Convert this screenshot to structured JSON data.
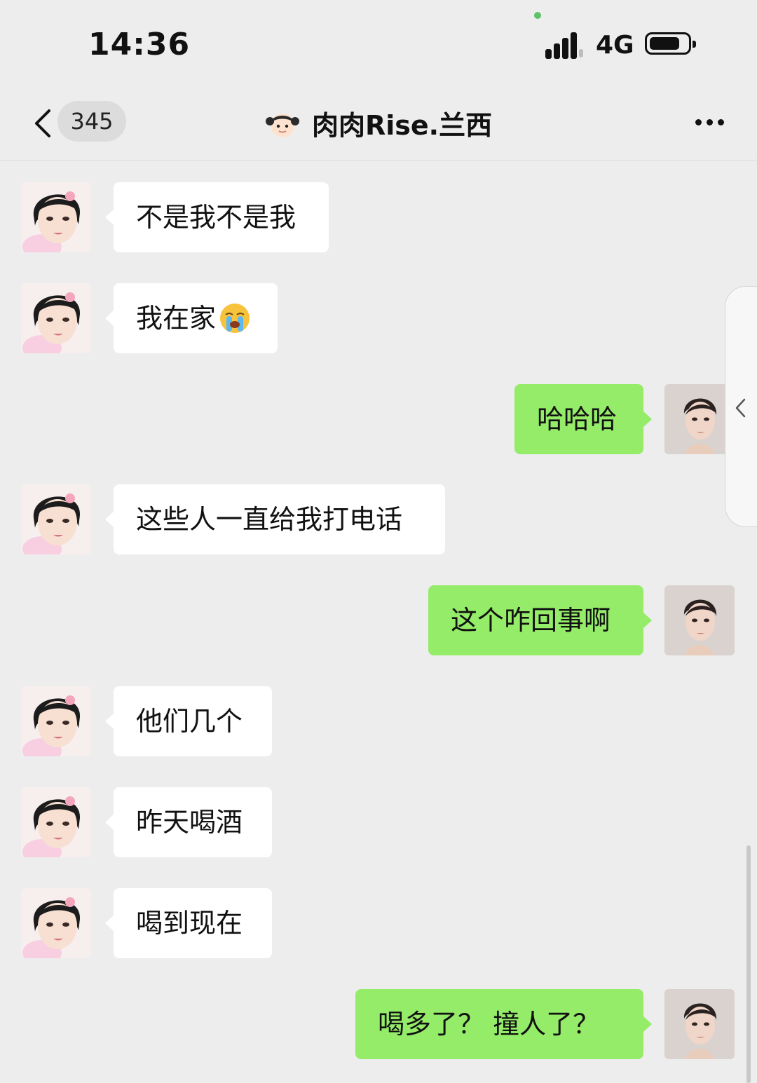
{
  "status_bar": {
    "time": "14:36",
    "network": "4G",
    "battery_level": 0.8,
    "signal_icon": "cellular-signal-icon",
    "battery_icon": "battery-icon"
  },
  "nav": {
    "back_icon": "chevron-left-icon",
    "unread_count": "345",
    "title": "肉肉Rise.兰西",
    "title_icon": "girl-emoji-icon",
    "more_icon": "more-dots-icon"
  },
  "messages": [
    {
      "side": "in",
      "text": "不是我不是我"
    },
    {
      "side": "in",
      "text": "我在家",
      "emoji": "crying-face-emoji"
    },
    {
      "side": "out",
      "text": "哈哈哈"
    },
    {
      "side": "in",
      "text": "这些人一直给我打电话"
    },
    {
      "side": "out",
      "text": "这个咋回事啊"
    },
    {
      "side": "in",
      "text": "他们几个"
    },
    {
      "side": "in",
      "text": "昨天喝酒"
    },
    {
      "side": "in",
      "text": "喝到现在"
    },
    {
      "side": "out",
      "text": "喝多了？ 撞人了？"
    }
  ],
  "colors": {
    "background": "#ededed",
    "incoming_bubble": "#ffffff",
    "outgoing_bubble": "#95ec69"
  }
}
